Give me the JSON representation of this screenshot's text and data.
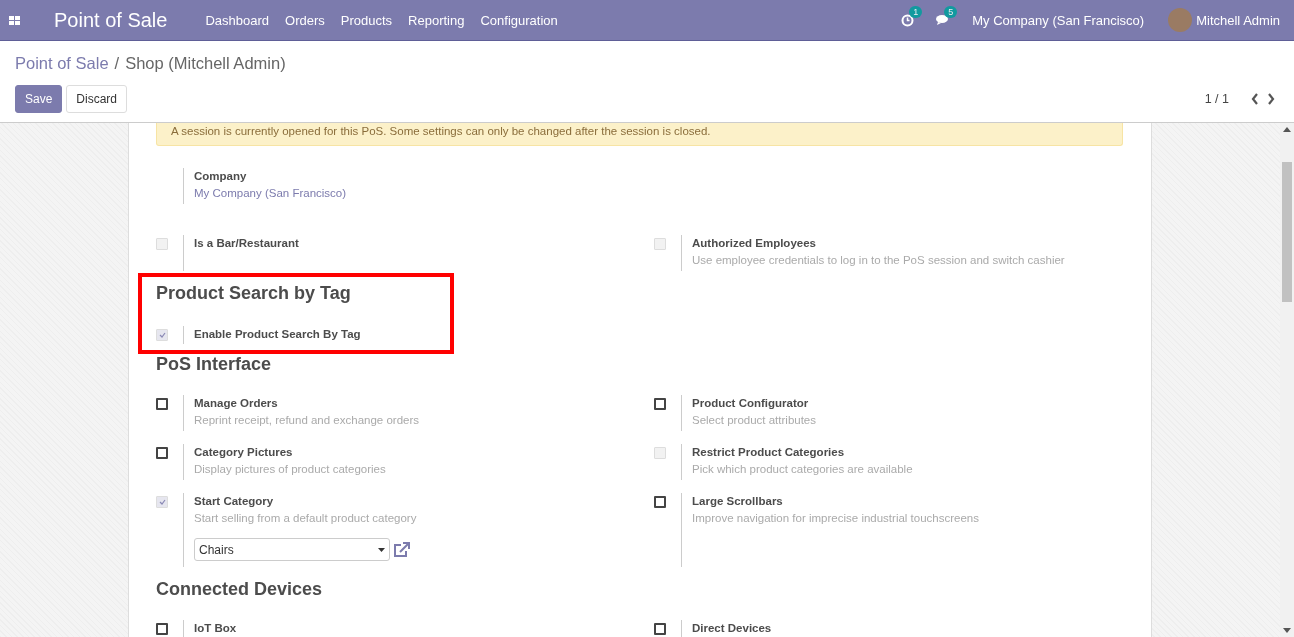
{
  "navbar": {
    "app_title": "Point of Sale",
    "menu": [
      "Dashboard",
      "Orders",
      "Products",
      "Reporting",
      "Configuration"
    ],
    "activity_count": "1",
    "message_count": "5",
    "company": "My Company (San Francisco)",
    "user": "Mitchell Admin"
  },
  "control_panel": {
    "breadcrumb": [
      {
        "label": "Point of Sale",
        "kind": "link"
      },
      {
        "label": "Shop (Mitchell Admin)",
        "kind": "current"
      }
    ],
    "separator": "/",
    "buttons": [
      {
        "label": "Save",
        "kind": "primary"
      },
      {
        "label": "Discard",
        "kind": "secondary"
      }
    ],
    "pager": "1 / 1"
  },
  "alert": "A session is currently opened for this PoS. Some settings can only be changed after the session is closed.",
  "sections": [
    {
      "highlighted": false,
      "rows": [
        [
          {
            "kind": "field",
            "label": "Company",
            "value": "My Company (San Francisco)"
          }
        ],
        [
          {
            "kind": "checkbox",
            "label": "Is a Bar/Restaurant",
            "checked": false,
            "disabled": true
          },
          {
            "kind": "checkbox",
            "label": "Authorized Employees",
            "description": "Use employee credentials to log in to the PoS session and switch cashier",
            "checked": false,
            "disabled": true
          }
        ]
      ]
    },
    {
      "title": "Product Search by Tag",
      "highlighted": true,
      "rows": [
        [
          {
            "kind": "checkbox",
            "label": "Enable Product Search By Tag",
            "checked": true,
            "disabled": true
          }
        ]
      ]
    },
    {
      "title": "PoS Interface",
      "highlighted": false,
      "rows": [
        [
          {
            "kind": "checkbox",
            "label": "Manage Orders",
            "description": "Reprint receipt, refund and exchange orders",
            "checked": false,
            "disabled": false
          },
          {
            "kind": "checkbox",
            "label": "Product Configurator",
            "description": "Select product attributes",
            "checked": false,
            "disabled": false
          }
        ],
        [
          {
            "kind": "checkbox",
            "label": "Category Pictures",
            "description": "Display pictures of product categories",
            "checked": false,
            "disabled": false
          },
          {
            "kind": "checkbox",
            "label": "Restrict Product Categories",
            "description": "Pick which product categories are available",
            "checked": false,
            "disabled": true
          }
        ],
        [
          {
            "kind": "checkbox",
            "label": "Start Category",
            "description": "Start selling from a default product category",
            "checked": true,
            "disabled": true,
            "select": "Chairs"
          },
          {
            "kind": "checkbox",
            "label": "Large Scrollbars",
            "description": "Improve navigation for imprecise industrial touchscreens",
            "checked": false,
            "disabled": false
          }
        ]
      ]
    },
    {
      "title": "Connected Devices",
      "highlighted": false,
      "rows": [
        [
          {
            "kind": "checkbox",
            "label": "IoT Box",
            "checked": false,
            "disabled": false
          },
          {
            "kind": "checkbox",
            "label": "Direct Devices",
            "checked": false,
            "disabled": false
          }
        ]
      ]
    }
  ]
}
